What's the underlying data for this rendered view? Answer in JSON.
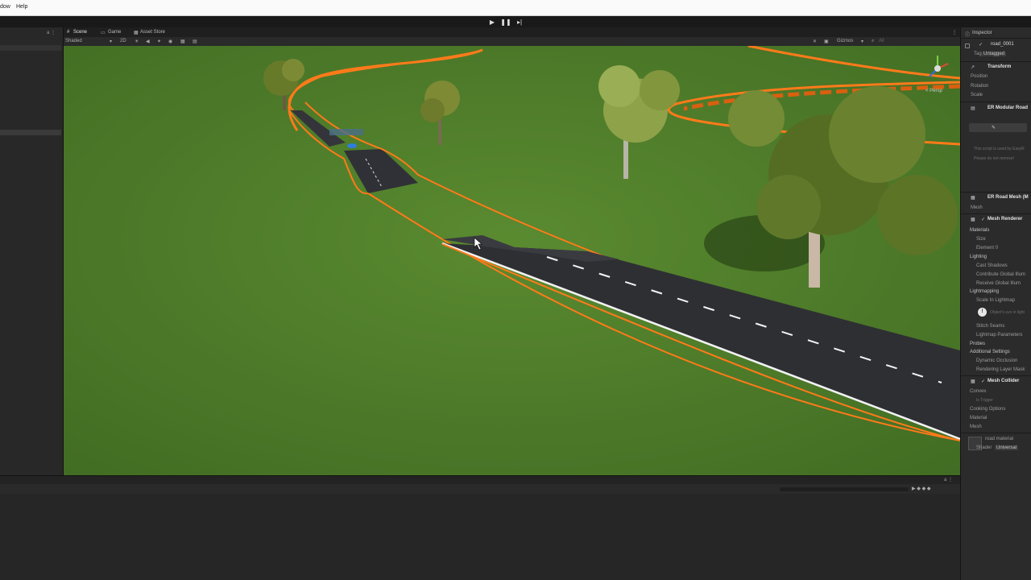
{
  "menu": {
    "items": [
      "dow",
      "Help"
    ]
  },
  "scene_tabs": [
    "Scene",
    "Game",
    "Asset Store"
  ],
  "scene_options": {
    "shading": "Shaded",
    "dim": "2D",
    "gizmos": "Gizmos",
    "search": "All"
  },
  "viewport": {
    "orientation_label": "< Persp"
  },
  "inspector": {
    "tab": "Inspector",
    "object_name": "road_0001",
    "tag_label": "Tag",
    "tag_value": "Untagged",
    "transform": {
      "title": "Transform",
      "fields": [
        "Position",
        "Rotation",
        "Scale"
      ]
    },
    "modular_road": {
      "title": "ER Modular Road",
      "note_line1": "This script is used by EasyR",
      "note_line2": "Please do not remove!"
    },
    "road_mesh": {
      "title": "ER Road Mesh (M",
      "field": "Mesh"
    },
    "mesh_renderer": {
      "title": "Mesh Renderer",
      "materials": "Materials",
      "size": "Size",
      "element0": "Element 0",
      "lighting": "Lighting",
      "cast_shadows": "Cast Shadows",
      "contribute_gi": "Contribute Global Illum",
      "receive_gi": "Receive Global Illum",
      "lightmapping": "Lightmapping",
      "scale_in_lightmap": "Scale In Lightmap",
      "warning": "Object's uvs in light",
      "stitch_seams": "Stitch Seams",
      "lightmap_params": "Lightmap Parameters",
      "probes": "Probes",
      "additional": "Additional Settings",
      "dynamic_occlusion": "Dynamic Occlusion",
      "rendering_layer": "Rendering Layer Mask"
    },
    "mesh_collider": {
      "title": "Mesh Collider",
      "convex": "Convex",
      "is_trigger": "Is Trigger",
      "cooking": "Cooking Options",
      "material": "Material",
      "mesh": "Mesh"
    },
    "material_preview": {
      "name": "road material",
      "shader_label": "Shader",
      "shader_value": "Universal"
    }
  },
  "colors": {
    "accent": "#3a79c9",
    "selection_outline": "#ff7a1a",
    "grass": "#4a7a28",
    "road": "#2e2f33"
  }
}
